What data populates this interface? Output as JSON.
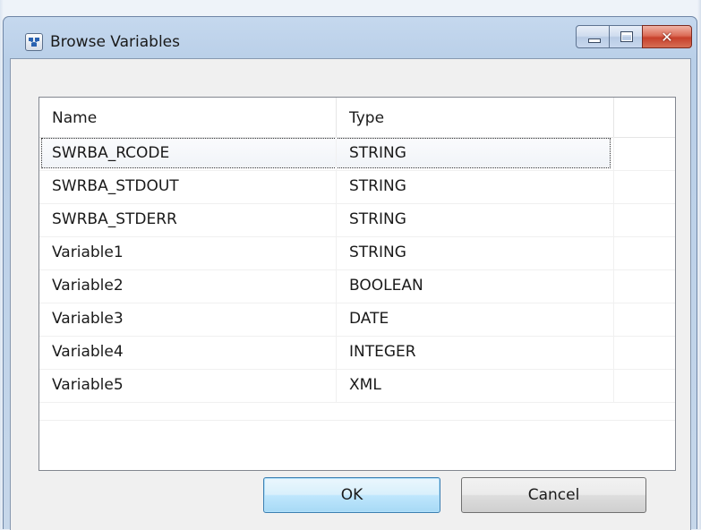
{
  "window": {
    "title": "Browse Variables"
  },
  "icons": {
    "app": "app-icon",
    "minimize": "minimize-icon",
    "maximize": "maximize-icon",
    "close": "close-icon"
  },
  "table": {
    "columns": [
      "Name",
      "Type"
    ],
    "rows": [
      {
        "name": "SWRBA_RCODE",
        "type": "STRING",
        "selected": true
      },
      {
        "name": "SWRBA_STDOUT",
        "type": "STRING",
        "selected": false
      },
      {
        "name": "SWRBA_STDERR",
        "type": "STRING",
        "selected": false
      },
      {
        "name": "Variable1",
        "type": "STRING",
        "selected": false
      },
      {
        "name": "Variable2",
        "type": "BOOLEAN",
        "selected": false
      },
      {
        "name": "Variable3",
        "type": "DATE",
        "selected": false
      },
      {
        "name": "Variable4",
        "type": "INTEGER",
        "selected": false
      },
      {
        "name": "Variable5",
        "type": "XML",
        "selected": false
      }
    ]
  },
  "buttons": {
    "ok": "OK",
    "cancel": "Cancel"
  },
  "caption": {
    "close_symbol": "✕"
  }
}
